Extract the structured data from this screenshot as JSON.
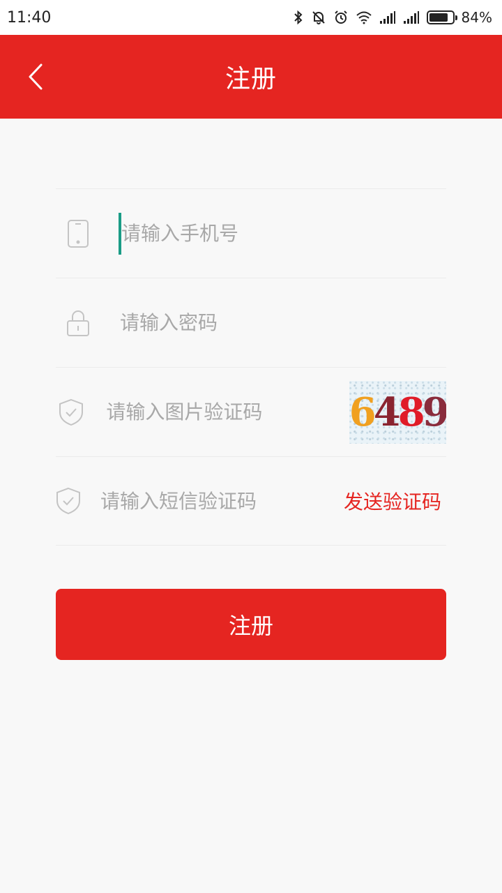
{
  "status_bar": {
    "time": "11:40",
    "battery_percent": "84%",
    "battery_level": 0.84
  },
  "app_bar": {
    "title": "注册",
    "back_icon": "chevron-left-icon"
  },
  "form": {
    "phone": {
      "placeholder": "请输入手机号",
      "value": "",
      "icon": "phone-icon"
    },
    "password": {
      "placeholder": "请输入密码",
      "value": "",
      "icon": "lock-icon"
    },
    "image_code": {
      "placeholder": "请输入图片验证码",
      "value": "",
      "icon": "shield-check-icon",
      "captcha_digits": [
        "6",
        "4",
        "8",
        "9"
      ]
    },
    "sms_code": {
      "placeholder": "请输入短信验证码",
      "value": "",
      "icon": "shield-check-icon",
      "send_label": "发送验证码"
    }
  },
  "submit": {
    "label": "注册"
  },
  "colors": {
    "primary": "#e52521",
    "background": "#f8f8f8",
    "placeholder": "#a8a8a8"
  }
}
